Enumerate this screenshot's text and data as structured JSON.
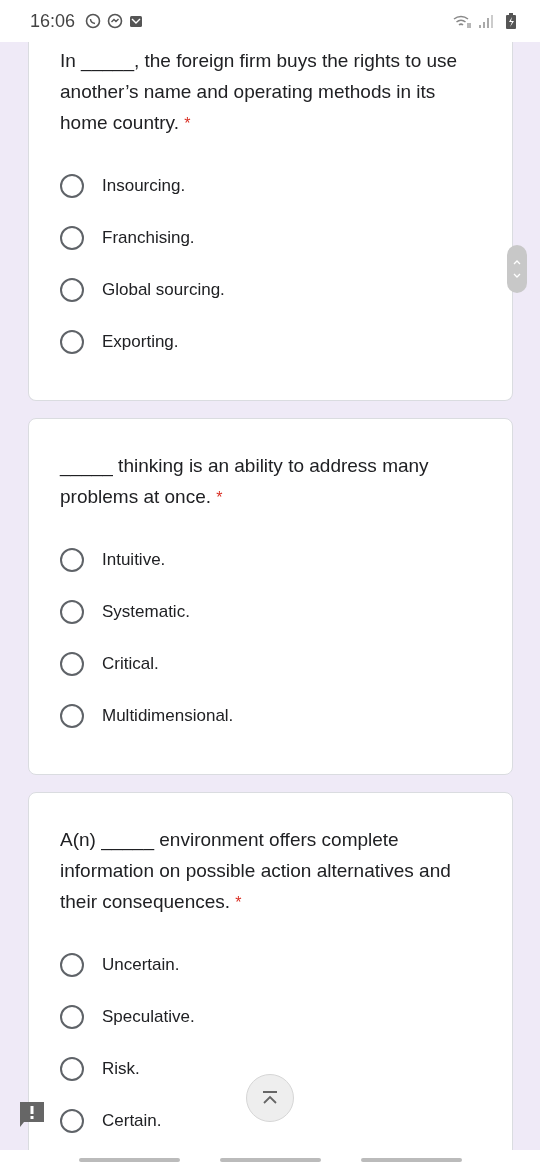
{
  "status_bar": {
    "time": "16:06"
  },
  "questions": [
    {
      "text": "In _____, the foreign firm buys the rights to use another’s name and operating methods in its home country.",
      "required_mark": "*",
      "options": [
        {
          "label": "Insourcing.",
          "selected": false
        },
        {
          "label": "Franchising.",
          "selected": false
        },
        {
          "label": "Global sourcing.",
          "selected": false
        },
        {
          "label": "Exporting.",
          "selected": false
        }
      ]
    },
    {
      "text": "_____ thinking is an ability to address many problems at once.",
      "required_mark": "*",
      "options": [
        {
          "label": "Intuitive.",
          "selected": false
        },
        {
          "label": "Systematic.",
          "selected": false
        },
        {
          "label": "Critical.",
          "selected": false
        },
        {
          "label": "Multidimensional.",
          "selected": false
        }
      ]
    },
    {
      "text": "A(n) _____ environment offers complete information on possible action alternatives and their consequences.",
      "required_mark": "*",
      "options": [
        {
          "label": "Uncertain.",
          "selected": false
        },
        {
          "label": "Speculative.",
          "selected": false
        },
        {
          "label": "Risk.",
          "selected": false
        },
        {
          "label": "Certain.",
          "selected": false
        }
      ]
    }
  ]
}
